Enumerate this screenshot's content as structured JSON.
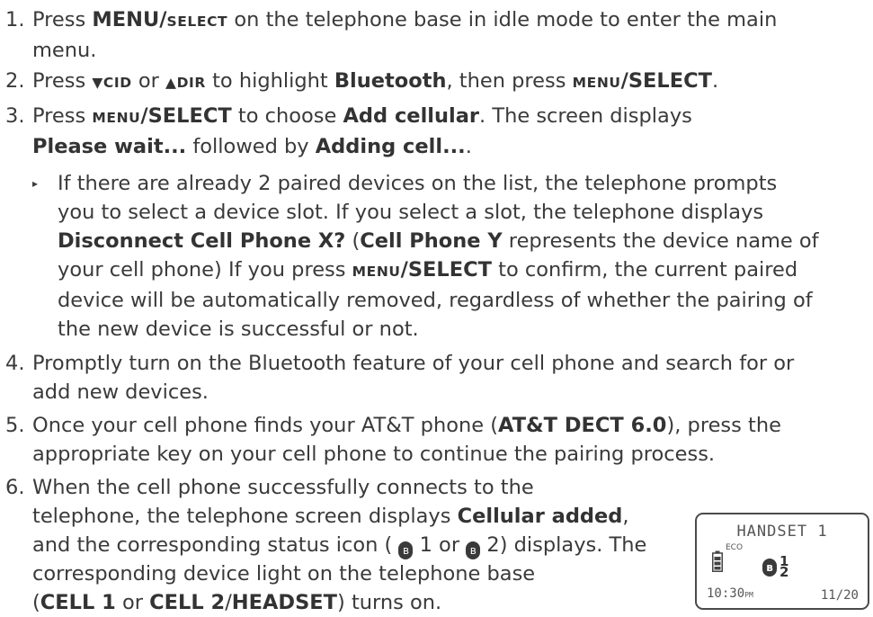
{
  "step1": {
    "num": "1.",
    "t1": "Press ",
    "menu": "MENU/",
    "select": "SELECT",
    "t2": " on the telephone base in idle mode to enter the main",
    "t3": "menu."
  },
  "step2": {
    "num": "2.",
    "t1": "Press ",
    "cid": "▼CID",
    "t2": " or ",
    "dir": "▲DIR",
    "t3": " to highlight ",
    "bluetooth": "Bluetooth",
    "t4": ", then press ",
    "menu": "MENU",
    "select": "/SELECT",
    "t5": "."
  },
  "step3": {
    "num": "3.",
    "t1": "Press ",
    "menu": "MENU",
    "select": "/SELECT",
    "t2": " to choose ",
    "add": "Add cellular",
    "t3": ". The screen displays",
    "wait": "Please wait...",
    "t4": " followed by ",
    "adding": "Adding cell...",
    "t5": "."
  },
  "bullet": {
    "mark": "▸",
    "l1": "If there are already 2 paired devices on the list, the telephone prompts",
    "l2": "you to select a device slot. If you select a slot, the telephone displays",
    "disconnect": "Disconnect Cell Phone X?",
    "l3a": " (",
    "cellY": "Cell Phone Y",
    "l3b": " represents the device name of",
    "l4a": "your cell phone) If you press ",
    "menu": "MENU",
    "select": "/SELECT",
    "l4b": " to confirm, the current paired",
    "l5": "device will be automatically removed, regardless of whether the pairing of",
    "l6": "the new device is successful or not."
  },
  "step4": {
    "num": "4.",
    "l1": "Promptly turn on the Bluetooth feature of your cell phone and search for or",
    "l2": "add new devices."
  },
  "step5": {
    "num": "5.",
    "l1a": "Once your cell phone finds your AT&T phone (",
    "dect": "AT&T DECT 6.0",
    "l1b": "), press the",
    "l2": "appropriate key on your cell phone to continue the pairing process."
  },
  "step6": {
    "num": "6.",
    "l1": "When the cell phone successfully connects to the",
    "l2a": "telephone, the telephone screen displays ",
    "added": "Cellular added",
    "l2b": ",",
    "l3a": "and the corresponding status icon ( ",
    "n1": " 1 or ",
    "n2": " 2) displays. The",
    "l4": "corresponding device light on the telephone base",
    "l5a": "(",
    "cell1": "CELL 1",
    "l5b": " or ",
    "cell2": "CELL 2",
    "slash": "/",
    "headset": "HEADSET",
    "l5c": ") turns on."
  },
  "lcd": {
    "title": "HANDSET 1",
    "eco": "ECO",
    "bt_super": "1",
    "bt_sub": "2",
    "time": "10:30",
    "ampm": "PM",
    "date": "11/20"
  }
}
